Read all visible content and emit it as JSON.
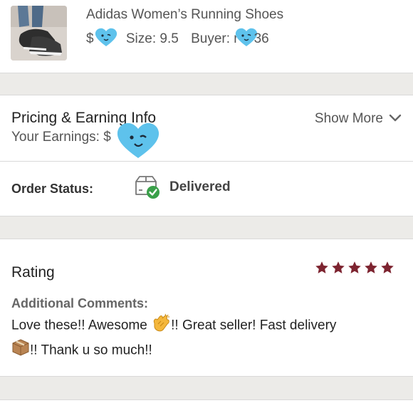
{
  "order": {
    "product_title": "Adidas Women’s Running Shoes",
    "price_prefix": "$",
    "size_text": "Size: 9.5",
    "buyer_prefix": "Buyer: r",
    "buyer_suffix": "36"
  },
  "pricing": {
    "title": "Pricing & Earning Info",
    "earnings_label": "Your Earnings: $",
    "show_more": "Show More"
  },
  "status": {
    "label": "Order Status:",
    "value": "Delivered"
  },
  "rating": {
    "title": "Rating",
    "stars": 5,
    "comments_label": "Additional Comments:",
    "comment_part1": "Love these!! Awesome ",
    "comment_part2": "!! Great seller! Fast delivery",
    "comment_part3": "!! Thank u so much!!"
  },
  "colors": {
    "star": "#7d2430",
    "delivered_check": "#3aa04a",
    "heart_sticker": "#5ec2ec"
  }
}
